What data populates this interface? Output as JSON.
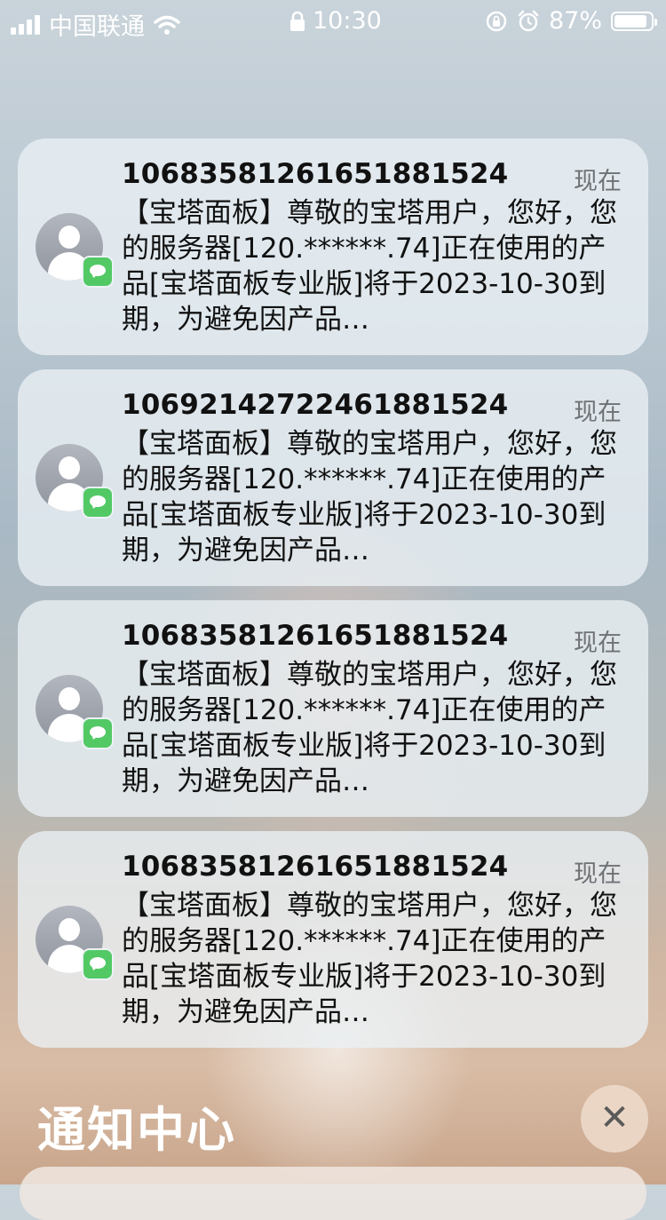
{
  "status_bar": {
    "carrier": "中国联通",
    "time": "10:30",
    "battery_percent": "87%",
    "icons": [
      "signal-bars-icon",
      "wifi-icon",
      "lock-icon",
      "orientation-lock-icon",
      "alarm-icon",
      "battery-icon"
    ]
  },
  "notifications": [
    {
      "sender": "1068358126165188152​4",
      "time": "现在",
      "body": "【宝塔面板】尊敬的宝塔用户，您好，您的服务器[120.******.74]正在使用的产品[宝塔面板专业版]将于2023-10-30到期，为避免因产品…"
    },
    {
      "sender": "10692142722461881524",
      "time": "现在",
      "body": "【宝塔面板】尊敬的宝塔用户，您好，您的服务器[120.******.74]正在使用的产品[宝塔面板专业版]将于2023-10-30到期，为避免因产品…"
    },
    {
      "sender": "10683581261651881524",
      "time": "现在",
      "body": "【宝塔面板】尊敬的宝塔用户，您好，您的服务器[120.******.74]正在使用的产品[宝塔面板专业版]将于2023-10-30到期，为避免因产品…"
    },
    {
      "sender": "10683581261651881524",
      "time": "现在",
      "body": "【宝塔面板】尊敬的宝塔用户，您好，您的服务器[120.******.74]正在使用的产品[宝塔面板专业版]将于2023-10-30到期，为避免因产品…"
    }
  ],
  "notification_center": {
    "title": "通知中心",
    "close_icon": "close-icon"
  }
}
